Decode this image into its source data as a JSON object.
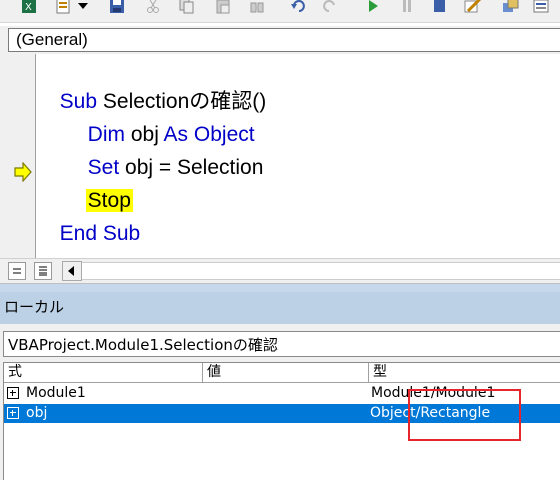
{
  "toolbar": {
    "icons": [
      "excel-icon",
      "insert-module-icon",
      "dropdown-icon",
      "save-icon",
      "cut-icon",
      "copy-icon",
      "paste-icon",
      "find-icon",
      "undo-icon",
      "redo-icon",
      "run-icon",
      "break-icon",
      "reset-icon",
      "design-mode-icon",
      "project-explorer-icon"
    ]
  },
  "editor": {
    "procedure_combo": "(General)",
    "lines": {
      "l1_kw": "Sub",
      "l1_tx": " Selectionの確認()",
      "l2_kw1": "Dim",
      "l2_tx": " obj ",
      "l2_kw2": "As Object",
      "l3_kw": "Set",
      "l3_tx": " obj = Selection",
      "l4_stop": "Stop",
      "l5_kw": "End Sub"
    }
  },
  "locals": {
    "title": "ローカル",
    "context": "VBAProject.Module1.Selectionの確認",
    "columns": [
      "式",
      "値",
      "型"
    ],
    "rows": [
      {
        "expr": "Module1",
        "value": "",
        "type": "Module1/Module1",
        "selected": false
      },
      {
        "expr": "obj",
        "value": "",
        "type": "Object/Rectangle",
        "selected": true
      }
    ]
  },
  "colors": {
    "keyword": "#0000c8",
    "stop_highlight": "#ffff00",
    "selection": "#0078d7",
    "annotation_box": "#e8242c"
  }
}
